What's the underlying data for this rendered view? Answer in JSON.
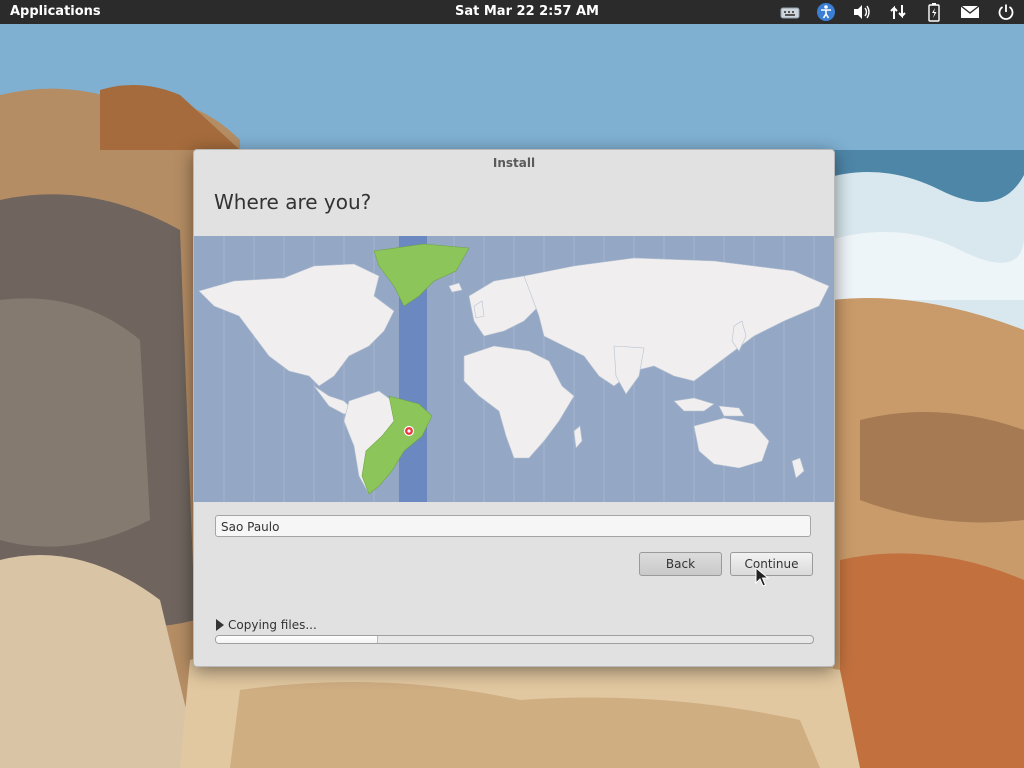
{
  "panel": {
    "applications_label": "Applications",
    "datetime": "Sat Mar 22  2:57 AM",
    "tray_icons": [
      "keyboard-icon",
      "accessibility-icon",
      "volume-icon",
      "network-icon",
      "battery-icon",
      "mail-icon",
      "power-icon"
    ]
  },
  "window": {
    "title": "Install",
    "heading": "Where are you?",
    "timezone_value": "Sao Paulo",
    "back_label": "Back",
    "continue_label": "Continue",
    "progress_label": "Copying files...",
    "progress_fraction": 0.27
  },
  "colors": {
    "panel_bg": "#2b2b2b",
    "window_bg": "#e1e1e1",
    "map_ocean": "#94a8c6",
    "land": "#f0eeee",
    "selected_zone": "#8cc65a",
    "timezone_band": "#6b88c0"
  }
}
